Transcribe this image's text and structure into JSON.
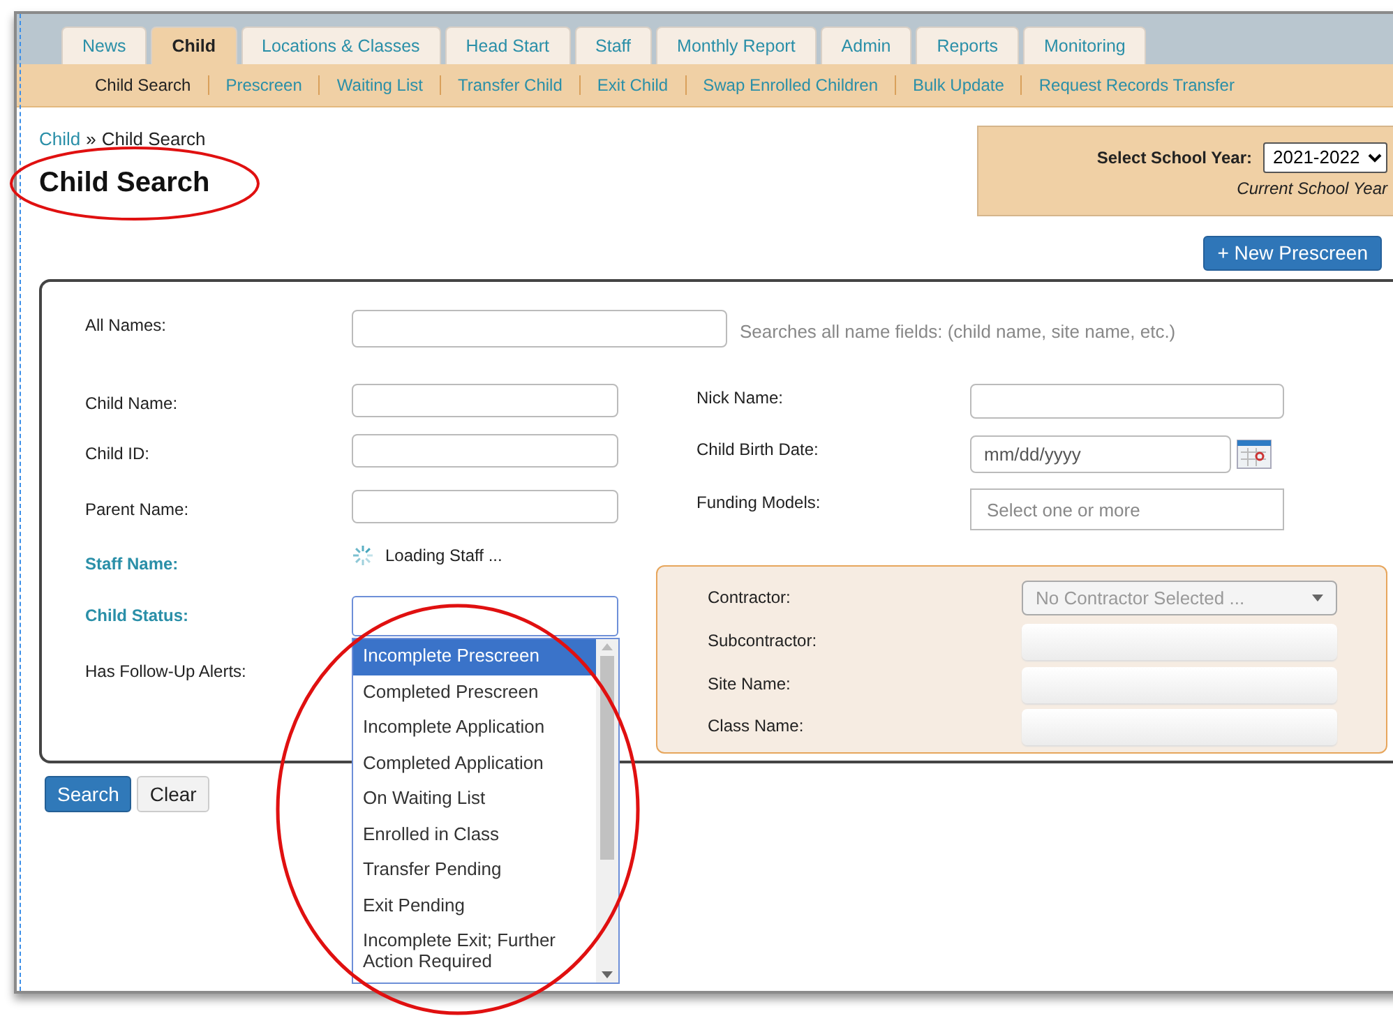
{
  "tabs": [
    {
      "label": "News",
      "selected": false
    },
    {
      "label": "Child",
      "selected": true
    },
    {
      "label": "Locations & Classes",
      "selected": false
    },
    {
      "label": "Head Start",
      "selected": false
    },
    {
      "label": "Staff",
      "selected": false
    },
    {
      "label": "Monthly Report",
      "selected": false
    },
    {
      "label": "Admin",
      "selected": false
    },
    {
      "label": "Reports",
      "selected": false
    },
    {
      "label": "Monitoring",
      "selected": false
    }
  ],
  "subnav": [
    {
      "label": "Child Search",
      "selected": true
    },
    {
      "label": "Prescreen",
      "selected": false
    },
    {
      "label": "Waiting List",
      "selected": false
    },
    {
      "label": "Transfer Child",
      "selected": false
    },
    {
      "label": "Exit Child",
      "selected": false
    },
    {
      "label": "Swap Enrolled Children",
      "selected": false
    },
    {
      "label": "Bulk Update",
      "selected": false
    },
    {
      "label": "Request Records Transfer",
      "selected": false
    }
  ],
  "breadcrumb": {
    "link": "Child",
    "separator": "»",
    "current": "Child Search"
  },
  "title": "Child Search",
  "school_year": {
    "label": "Select School Year:",
    "value": "2021-2022",
    "note": "Current School Year"
  },
  "new_button": "+ New Prescreen",
  "all_names": {
    "label": "All Names:",
    "hint": "Searches all name fields: (child name, site name, etc.)"
  },
  "left_fields": [
    {
      "label": "Child Name:",
      "kind": "text",
      "emphasized": false
    },
    {
      "label": "Child ID:",
      "kind": "text",
      "emphasized": false
    },
    {
      "label": "Parent Name:",
      "kind": "text",
      "emphasized": false
    },
    {
      "label": "Staff Name:",
      "kind": "loading",
      "emphasized": true,
      "text": "Loading Staff ..."
    },
    {
      "label": "Child Status:",
      "kind": "listbox",
      "emphasized": true
    },
    {
      "label": "Has Follow-Up Alerts:",
      "kind": "none",
      "emphasized": false
    }
  ],
  "right_fields": [
    {
      "label": "Nick Name:",
      "kind": "text"
    },
    {
      "label": "Child Birth Date:",
      "kind": "date",
      "placeholder": "mm/dd/yyyy"
    },
    {
      "label": "Funding Models:",
      "kind": "multi",
      "placeholder": "Select one or more"
    }
  ],
  "location_fields": [
    {
      "label": "Contractor:",
      "kind": "select",
      "value": "No Contractor Selected ..."
    },
    {
      "label": "Subcontractor:",
      "kind": "blank"
    },
    {
      "label": "Site Name:",
      "kind": "blank"
    },
    {
      "label": "Class Name:",
      "kind": "blank"
    }
  ],
  "status_options": [
    {
      "label": "Incomplete Prescreen",
      "selected": true
    },
    {
      "label": "Completed Prescreen",
      "selected": false
    },
    {
      "label": "Incomplete Application",
      "selected": false
    },
    {
      "label": "Completed Application",
      "selected": false
    },
    {
      "label": "On Waiting List",
      "selected": false
    },
    {
      "label": "Enrolled in Class",
      "selected": false
    },
    {
      "label": "Transfer Pending",
      "selected": false
    },
    {
      "label": "Exit Pending",
      "selected": false
    },
    {
      "label": "Incomplete Exit; Further Action Required",
      "selected": false
    }
  ],
  "buttons": {
    "search": "Search",
    "clear": "Clear"
  }
}
